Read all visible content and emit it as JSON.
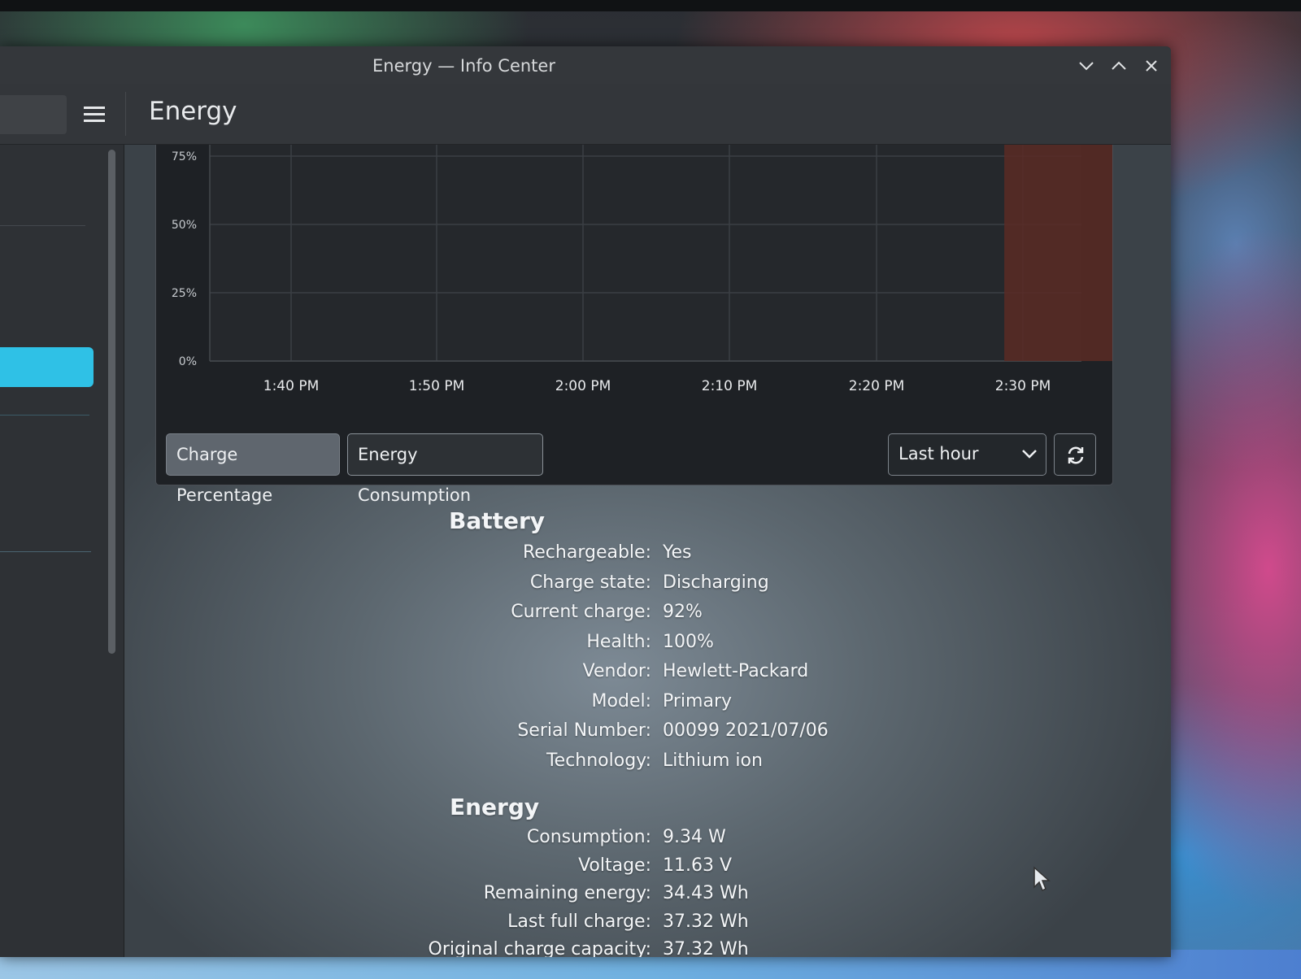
{
  "window": {
    "title": "Energy — Info Center",
    "controls": [
      "minimize",
      "maximize",
      "close"
    ]
  },
  "header": {
    "page_title": "Energy",
    "menu_icon": "hamburger-menu-icon"
  },
  "chart_data": {
    "type": "area",
    "ylabel_ticks": [
      "0%",
      "25%",
      "50%",
      "75%"
    ],
    "x": [
      "1:40 PM",
      "1:50 PM",
      "2:00 PM",
      "2:10 PM",
      "2:20 PM",
      "2:30 PM"
    ],
    "ylim": [
      0,
      75
    ],
    "grid": true,
    "series": [
      {
        "x_start": "2:29 PM",
        "x_end": "2:38 PM",
        "value": 92,
        "color": "#5a2a24"
      }
    ]
  },
  "controls": {
    "charge_percentage": "Charge Percentage",
    "energy_consumption": "Energy Consumption",
    "time_range": "Last hour",
    "refresh_icon": "refresh-icon"
  },
  "battery": {
    "heading": "Battery",
    "rows": [
      {
        "label": "Rechargeable:",
        "value": "Yes"
      },
      {
        "label": "Charge state:",
        "value": "Discharging"
      },
      {
        "label": "Current charge:",
        "value": "92%"
      },
      {
        "label": "Health:",
        "value": "100%"
      },
      {
        "label": "Vendor:",
        "value": "Hewlett-Packard"
      },
      {
        "label": "Model:",
        "value": "Primary"
      },
      {
        "label": "Serial Number:",
        "value": "00099 2021/07/06"
      },
      {
        "label": "Technology:",
        "value": "Lithium ion"
      }
    ]
  },
  "energy": {
    "heading": "Energy",
    "rows": [
      {
        "label": "Consumption:",
        "value": "9.34 W"
      },
      {
        "label": "Voltage:",
        "value": "11.63 V"
      },
      {
        "label": "Remaining energy:",
        "value": "34.43 Wh"
      },
      {
        "label": "Last full charge:",
        "value": "37.32 Wh"
      },
      {
        "label": "Original charge capacity:",
        "value": "37.32 Wh"
      }
    ]
  }
}
